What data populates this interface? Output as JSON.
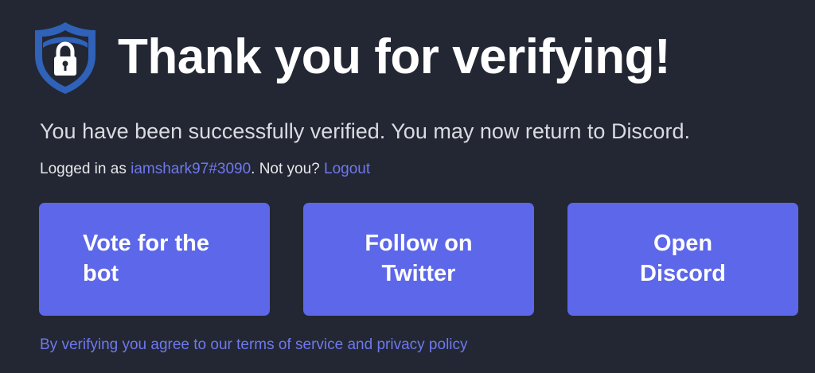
{
  "header": {
    "title": "Thank you for verifying!",
    "icon": "shield-lock-icon"
  },
  "message": "You have been successfully verified. You may now return to Discord.",
  "login": {
    "prefix": "Logged in as ",
    "username": "iamshark97#3090",
    "middle": ". Not you? ",
    "logout_label": "Logout"
  },
  "buttons": [
    {
      "label": "Vote for the bot"
    },
    {
      "label": "Follow on Twitter"
    },
    {
      "label": "Open Discord"
    }
  ],
  "footer": {
    "text": "By verifying you agree to our terms of service and privacy policy"
  },
  "colors": {
    "background": "#222733",
    "accent": "#5c67ea",
    "link": "#6f78ee",
    "shield_blue": "#2f62b8"
  }
}
